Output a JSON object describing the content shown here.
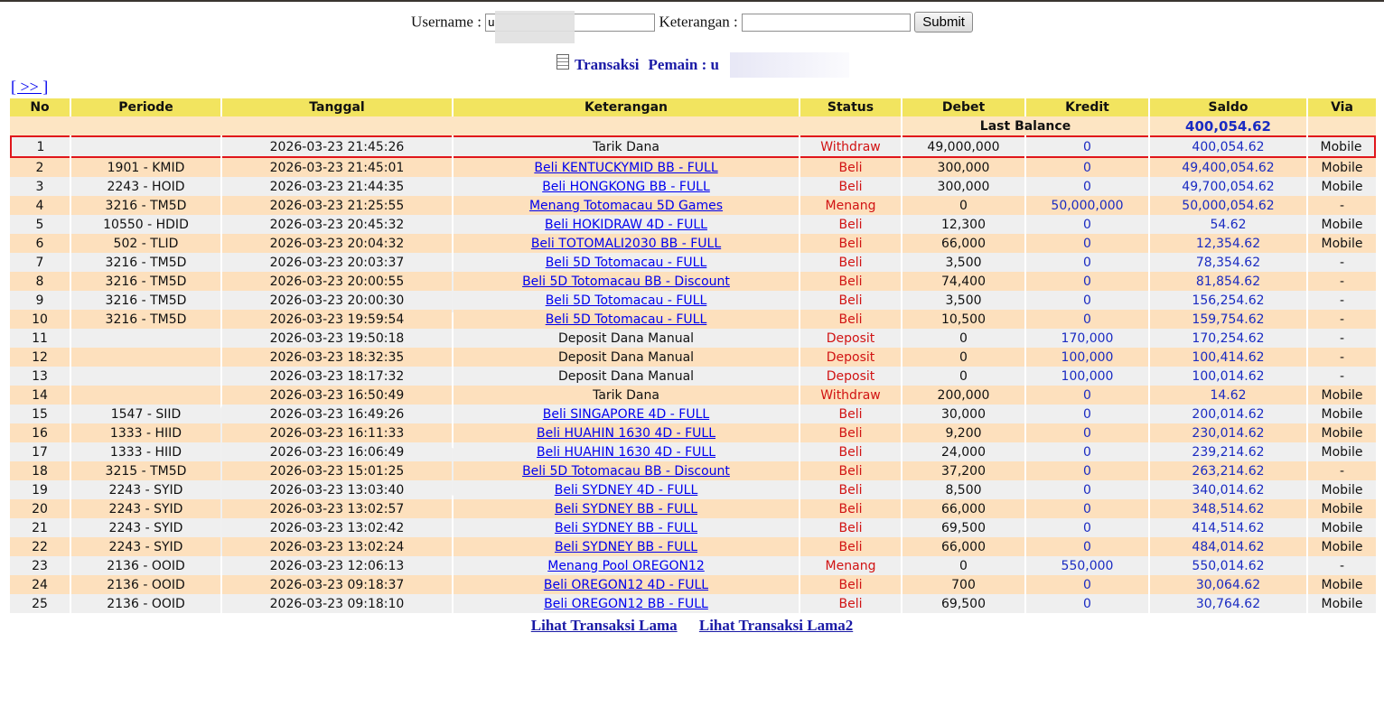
{
  "form": {
    "username_label": "Username :",
    "username_value": "u",
    "keterangan_label": "Keterangan :",
    "keterangan_value": "",
    "submit_label": "Submit"
  },
  "heading": {
    "transaksi": "Transaksi",
    "pemain_label": "Pemain : ",
    "pemain_value": "u"
  },
  "next_link": "[ >> ]",
  "table": {
    "headers": [
      "No",
      "Periode",
      "Tanggal",
      "Keterangan",
      "Status",
      "Debet",
      "Kredit",
      "Saldo",
      "Via"
    ],
    "last_balance_label": "Last Balance",
    "last_balance_value": "400,054.62",
    "rows": [
      {
        "no": "1",
        "periode": "",
        "tanggal": "2026-03-23 21:45:26",
        "keterangan": "Tarik Dana",
        "link": false,
        "status": "Withdraw",
        "debet": "49,000,000",
        "kredit": "0",
        "saldo": "400,054.62",
        "via": "Mobile",
        "highlighted": true
      },
      {
        "no": "2",
        "periode": "1901 - KMID",
        "tanggal": "2026-03-23 21:45:01",
        "keterangan": "Beli KENTUCKYMID BB - FULL",
        "link": true,
        "status": "Beli",
        "debet": "300,000",
        "kredit": "0",
        "saldo": "49,400,054.62",
        "via": "Mobile"
      },
      {
        "no": "3",
        "periode": "2243 - HOID",
        "tanggal": "2026-03-23 21:44:35",
        "keterangan": "Beli HONGKONG BB - FULL",
        "link": true,
        "status": "Beli",
        "debet": "300,000",
        "kredit": "0",
        "saldo": "49,700,054.62",
        "via": "Mobile"
      },
      {
        "no": "4",
        "periode": "3216 - TM5D",
        "tanggal": "2026-03-23 21:25:55",
        "keterangan": "Menang Totomacau 5D Games",
        "link": true,
        "status": "Menang",
        "debet": "0",
        "kredit": "50,000,000",
        "saldo": "50,000,054.62",
        "via": "-"
      },
      {
        "no": "5",
        "periode": "10550 - HDID",
        "tanggal": "2026-03-23 20:45:32",
        "keterangan": "Beli HOKIDRAW 4D - FULL",
        "link": true,
        "status": "Beli",
        "debet": "12,300",
        "kredit": "0",
        "saldo": "54.62",
        "via": "Mobile"
      },
      {
        "no": "6",
        "periode": "502 - TLID",
        "tanggal": "2026-03-23 20:04:32",
        "keterangan": "Beli TOTOMALI2030 BB - FULL",
        "link": true,
        "status": "Beli",
        "debet": "66,000",
        "kredit": "0",
        "saldo": "12,354.62",
        "via": "Mobile"
      },
      {
        "no": "7",
        "periode": "3216 - TM5D",
        "tanggal": "2026-03-23 20:03:37",
        "keterangan": "Beli 5D Totomacau - FULL",
        "link": true,
        "status": "Beli",
        "debet": "3,500",
        "kredit": "0",
        "saldo": "78,354.62",
        "via": "-"
      },
      {
        "no": "8",
        "periode": "3216 - TM5D",
        "tanggal": "2026-03-23 20:00:55",
        "keterangan": "Beli 5D Totomacau BB - Discount",
        "link": true,
        "status": "Beli",
        "debet": "74,400",
        "kredit": "0",
        "saldo": "81,854.62",
        "via": "-"
      },
      {
        "no": "9",
        "periode": "3216 - TM5D",
        "tanggal": "2026-03-23 20:00:30",
        "keterangan": "Beli 5D Totomacau - FULL",
        "link": true,
        "status": "Beli",
        "debet": "3,500",
        "kredit": "0",
        "saldo": "156,254.62",
        "via": "-"
      },
      {
        "no": "10",
        "periode": "3216 - TM5D",
        "tanggal": "2026-03-23 19:59:54",
        "keterangan": "Beli 5D Totomacau - FULL",
        "link": true,
        "status": "Beli",
        "debet": "10,500",
        "kredit": "0",
        "saldo": "159,754.62",
        "via": "-"
      },
      {
        "no": "11",
        "periode": "",
        "tanggal": "2026-03-23 19:50:18",
        "keterangan": "Deposit Dana Manual",
        "link": false,
        "status": "Deposit",
        "debet": "0",
        "kredit": "170,000",
        "saldo": "170,254.62",
        "via": "-"
      },
      {
        "no": "12",
        "periode": "",
        "tanggal": "2026-03-23 18:32:35",
        "keterangan": "Deposit Dana Manual",
        "link": false,
        "status": "Deposit",
        "debet": "0",
        "kredit": "100,000",
        "saldo": "100,414.62",
        "via": "-"
      },
      {
        "no": "13",
        "periode": "",
        "tanggal": "2026-03-23 18:17:32",
        "keterangan": "Deposit Dana Manual",
        "link": false,
        "status": "Deposit",
        "debet": "0",
        "kredit": "100,000",
        "saldo": "100,014.62",
        "via": "-"
      },
      {
        "no": "14",
        "periode": "",
        "tanggal": "2026-03-23 16:50:49",
        "keterangan": "Tarik Dana",
        "link": false,
        "status": "Withdraw",
        "debet": "200,000",
        "kredit": "0",
        "saldo": "14.62",
        "via": "Mobile"
      },
      {
        "no": "15",
        "periode": "1547 - SIID",
        "tanggal": "2026-03-23 16:49:26",
        "keterangan": "Beli SINGAPORE 4D - FULL",
        "link": true,
        "status": "Beli",
        "debet": "30,000",
        "kredit": "0",
        "saldo": "200,014.62",
        "via": "Mobile"
      },
      {
        "no": "16",
        "periode": "1333 - HIID",
        "tanggal": "2026-03-23 16:11:33",
        "keterangan": "Beli HUAHIN 1630 4D - FULL",
        "link": true,
        "status": "Beli",
        "debet": "9,200",
        "kredit": "0",
        "saldo": "230,014.62",
        "via": "Mobile"
      },
      {
        "no": "17",
        "periode": "1333 - HIID",
        "tanggal": "2026-03-23 16:06:49",
        "keterangan": "Beli HUAHIN 1630 4D - FULL",
        "link": true,
        "status": "Beli",
        "debet": "24,000",
        "kredit": "0",
        "saldo": "239,214.62",
        "via": "Mobile"
      },
      {
        "no": "18",
        "periode": "3215 - TM5D",
        "tanggal": "2026-03-23 15:01:25",
        "keterangan": "Beli 5D Totomacau BB - Discount",
        "link": true,
        "status": "Beli",
        "debet": "37,200",
        "kredit": "0",
        "saldo": "263,214.62",
        "via": "-"
      },
      {
        "no": "19",
        "periode": "2243 - SYID",
        "tanggal": "2026-03-23 13:03:40",
        "keterangan": "Beli SYDNEY 4D - FULL",
        "link": true,
        "status": "Beli",
        "debet": "8,500",
        "kredit": "0",
        "saldo": "340,014.62",
        "via": "Mobile"
      },
      {
        "no": "20",
        "periode": "2243 - SYID",
        "tanggal": "2026-03-23 13:02:57",
        "keterangan": "Beli SYDNEY BB - FULL",
        "link": true,
        "status": "Beli",
        "debet": "66,000",
        "kredit": "0",
        "saldo": "348,514.62",
        "via": "Mobile"
      },
      {
        "no": "21",
        "periode": "2243 - SYID",
        "tanggal": "2026-03-23 13:02:42",
        "keterangan": "Beli SYDNEY BB - FULL",
        "link": true,
        "status": "Beli",
        "debet": "69,500",
        "kredit": "0",
        "saldo": "414,514.62",
        "via": "Mobile"
      },
      {
        "no": "22",
        "periode": "2243 - SYID",
        "tanggal": "2026-03-23 13:02:24",
        "keterangan": "Beli SYDNEY BB - FULL",
        "link": true,
        "status": "Beli",
        "debet": "66,000",
        "kredit": "0",
        "saldo": "484,014.62",
        "via": "Mobile"
      },
      {
        "no": "23",
        "periode": "2136 - OOID",
        "tanggal": "2026-03-23 12:06:13",
        "keterangan": "Menang Pool OREGON12",
        "link": true,
        "status": "Menang",
        "debet": "0",
        "kredit": "550,000",
        "saldo": "550,014.62",
        "via": "-"
      },
      {
        "no": "24",
        "periode": "2136 - OOID",
        "tanggal": "2026-03-23 09:18:37",
        "keterangan": "Beli OREGON12 4D - FULL",
        "link": true,
        "status": "Beli",
        "debet": "700",
        "kredit": "0",
        "saldo": "30,064.62",
        "via": "Mobile"
      },
      {
        "no": "25",
        "periode": "2136 - OOID",
        "tanggal": "2026-03-23 09:18:10",
        "keterangan": "Beli OREGON12 BB - FULL",
        "link": true,
        "status": "Beli",
        "debet": "69,500",
        "kredit": "0",
        "saldo": "30,764.62",
        "via": "Mobile"
      }
    ]
  },
  "footer": {
    "link1": "Lihat Transaksi Lama",
    "link2": "Lihat Transaksi Lama2"
  },
  "colors": {
    "header_bg": "#f2e45f",
    "row_odd": "#efefef",
    "row_even": "#fde0bd",
    "status_red": "#d11313",
    "value_blue": "#1a2bc2",
    "highlight_border": "#e0161b"
  }
}
